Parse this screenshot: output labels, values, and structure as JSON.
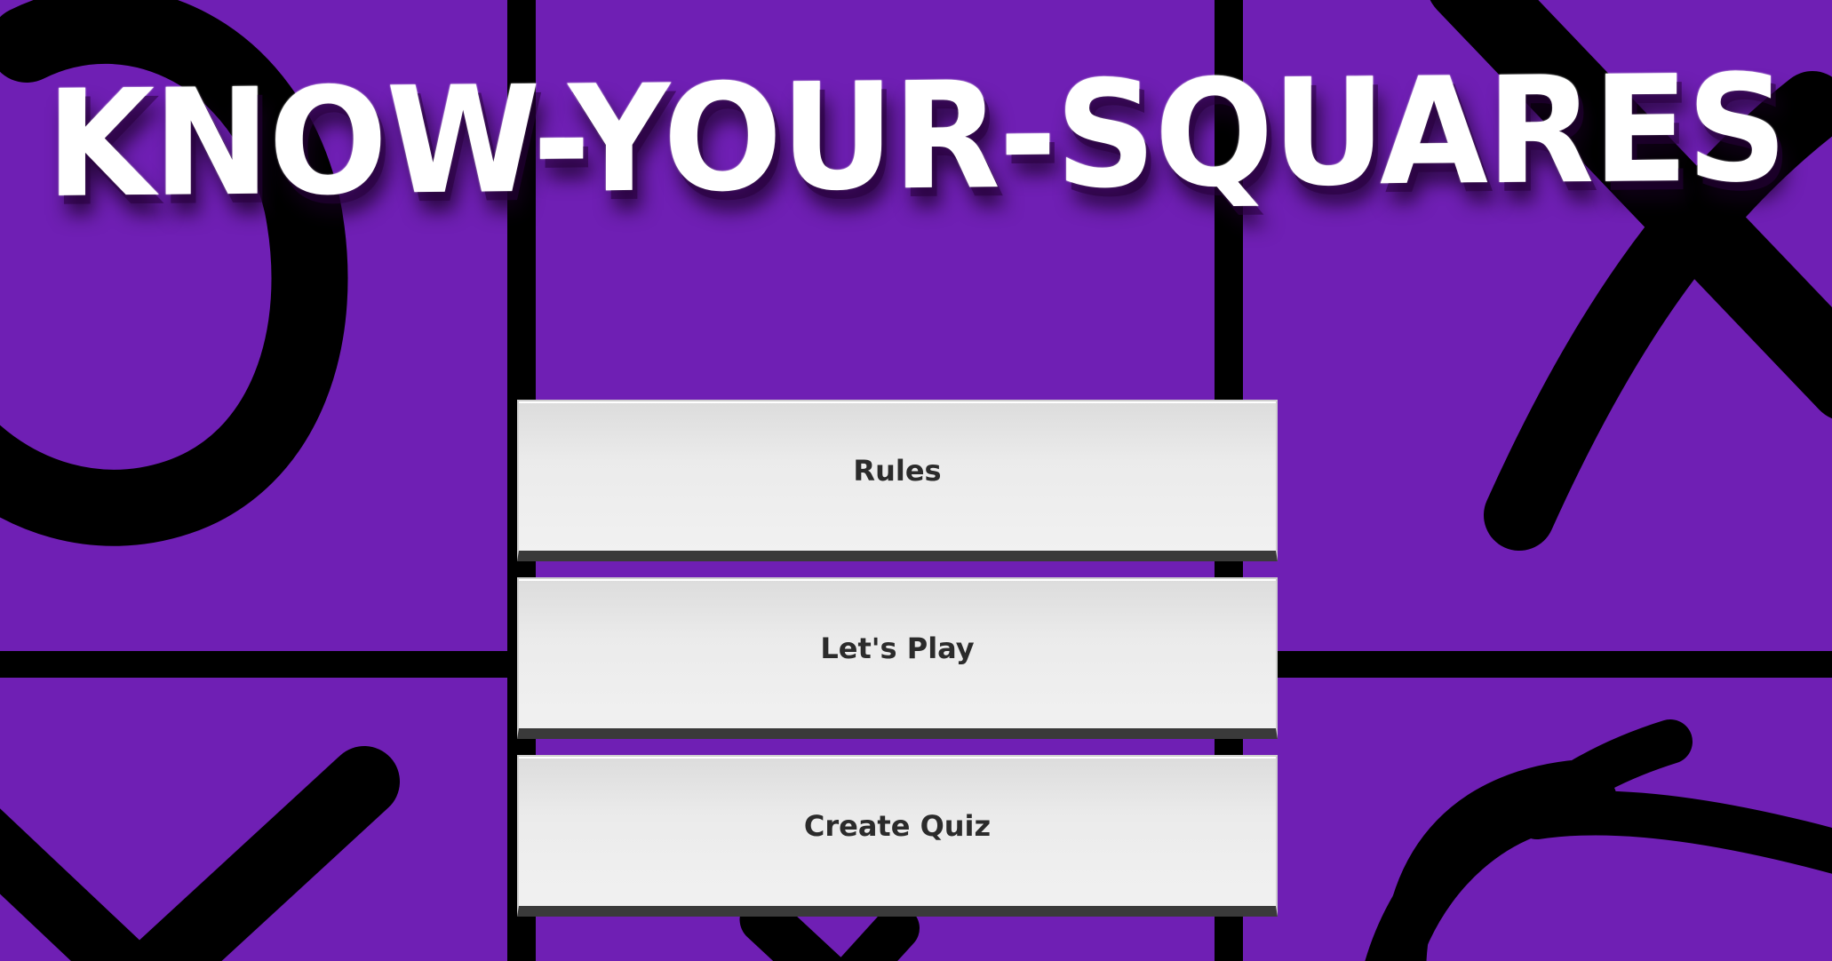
{
  "game": {
    "title": "KNOW-YOUR-SQUARES",
    "colors": {
      "board": "#6f1fb4",
      "grid_lines": "#000000",
      "marks": "#000000",
      "title_text": "#ffffff",
      "button_face": "#ececec",
      "button_text": "#2b2b2b"
    },
    "background_marks": [
      {
        "square": "top-left",
        "mark": "O"
      },
      {
        "square": "top-right",
        "mark": "X"
      },
      {
        "square": "bottom-left",
        "mark": "X"
      },
      {
        "square": "bottom-middle",
        "mark": "X"
      },
      {
        "square": "bottom-right",
        "mark": "O"
      }
    ]
  },
  "menu": {
    "rules_label": "Rules",
    "play_label": "Let's Play",
    "create_quiz_label": "Create Quiz"
  }
}
